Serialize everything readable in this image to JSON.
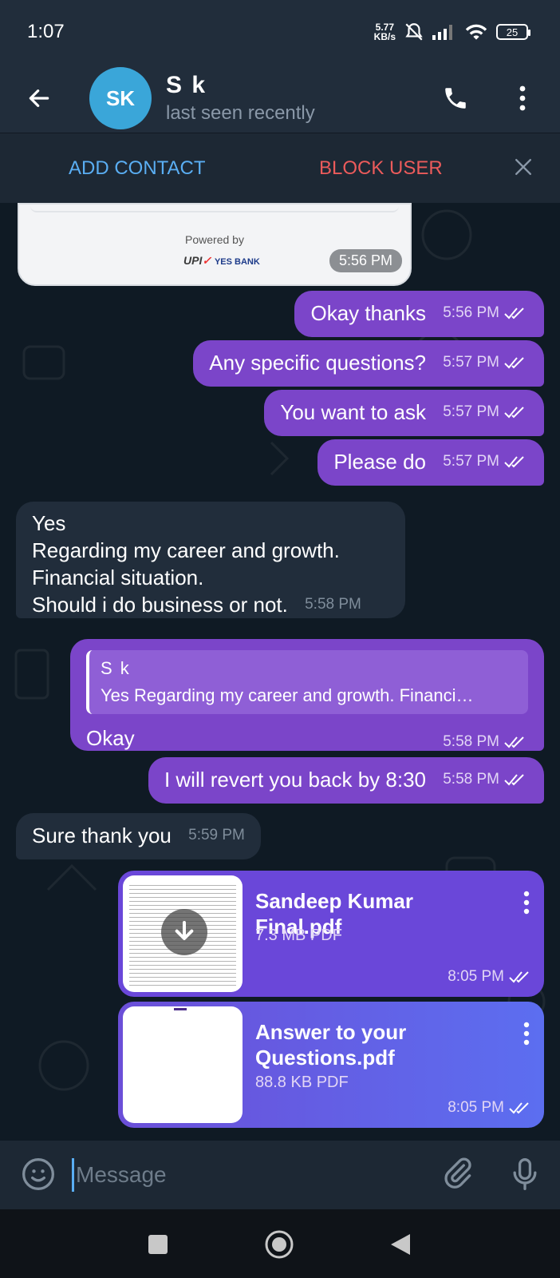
{
  "status_bar": {
    "time": "1:07",
    "speed_value": "5.77",
    "speed_unit": "KB/s",
    "battery": "25"
  },
  "header": {
    "avatar_initials": "SK",
    "name": "S k",
    "status": "last seen recently"
  },
  "action_bar": {
    "add_contact": "ADD CONTACT",
    "block_user": "BLOCK USER"
  },
  "payment_card": {
    "powered_by": "Powered by",
    "upi": "UPI",
    "bank": "YES BANK",
    "time": "5:56 PM"
  },
  "messages": [
    {
      "text": "Okay thanks",
      "time": "5:56 PM"
    },
    {
      "text": "Any specific questions?",
      "time": "5:57 PM"
    },
    {
      "text": "You want to ask",
      "time": "5:57 PM"
    },
    {
      "text": "Please do",
      "time": "5:57 PM"
    },
    {
      "lines": [
        "Yes",
        "Regarding my career and growth.",
        "Financial situation.",
        "Should i do business or not."
      ],
      "time": "5:58 PM"
    },
    {
      "reply_name": "S k",
      "reply_text": "Yes Regarding my career and growth. Financi…",
      "text": "Okay",
      "time": "5:58 PM"
    },
    {
      "text": "I will revert you back by 8:30",
      "time": "5:58 PM"
    },
    {
      "text": "Sure thank you",
      "time": "5:59 PM"
    }
  ],
  "files": [
    {
      "name": "Sandeep Kumar Final.pdf",
      "size": "7.3 MB PDF",
      "time": "8:05 PM"
    },
    {
      "name": "Answer to your Questions.pdf",
      "size": "88.8 KB PDF",
      "time": "8:05 PM"
    }
  ],
  "input": {
    "placeholder": "Message"
  },
  "icons": [
    "back-arrow-icon",
    "phone-icon",
    "more-vert-icon",
    "close-icon",
    "double-check-icon",
    "download-icon",
    "emoji-icon",
    "attach-icon",
    "mic-icon",
    "nav-home-icon",
    "nav-back-icon",
    "nav-recents-icon"
  ]
}
